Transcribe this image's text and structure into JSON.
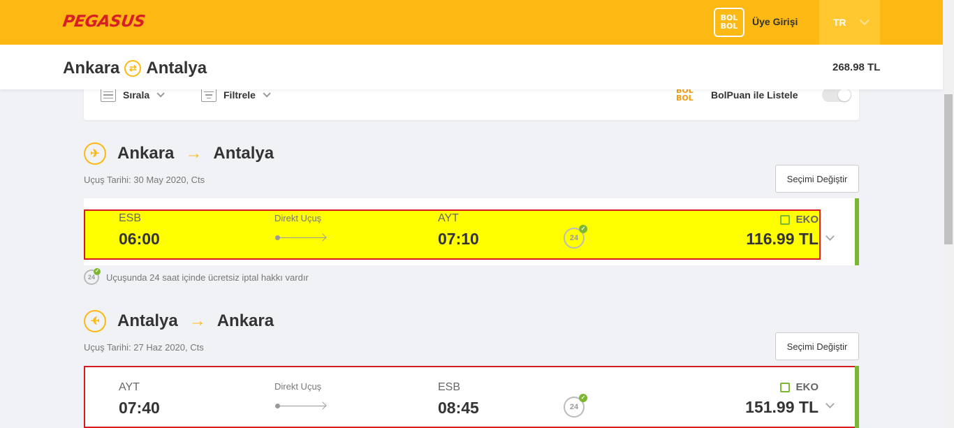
{
  "header": {
    "logo_text": "PEGASUS",
    "bolbol_top": "BOL",
    "bolbol_bottom": "BOL",
    "login_label": "Üye Girişi",
    "language": "TR"
  },
  "trip": {
    "origin": "Ankara",
    "destination": "Antalya",
    "total_price": "268.98 TL"
  },
  "toolbar": {
    "sort_label": "Sırala",
    "filter_label": "Filtrele",
    "bolpuan_label": "BolPuan ile Listele"
  },
  "legs": [
    {
      "from": "Ankara",
      "to": "Antalya",
      "date": "Uçuş Tarihi: 30 May 2020, Cts",
      "change_label": "Seçimi Değiştir",
      "flight": {
        "dep_code": "ESB",
        "dep_time": "06:00",
        "type": "Direkt Uçuş",
        "arr_code": "AYT",
        "arr_time": "07:10",
        "fare_class": "EKO",
        "price": "116.99 TL"
      },
      "cancel_note": "Uçuşunda 24 saat içinde ücretsiz iptal hakkı vardır"
    },
    {
      "from": "Antalya",
      "to": "Ankara",
      "date": "Uçuş Tarihi: 27 Haz 2020, Cts",
      "change_label": "Seçimi Değiştir",
      "flight": {
        "dep_code": "AYT",
        "dep_time": "07:40",
        "type": "Direkt Uçuş",
        "arr_code": "ESB",
        "arr_time": "08:45",
        "fare_class": "EKO",
        "price": "151.99 TL"
      }
    }
  ],
  "icons": {
    "cancel_badge_text": "24",
    "swap_glyph": "⇄",
    "plane_glyph": "✈",
    "arrow_glyph": "→"
  },
  "colors": {
    "brand": "#fdb913",
    "brand_red": "#d81f26",
    "success": "#7cb632"
  }
}
